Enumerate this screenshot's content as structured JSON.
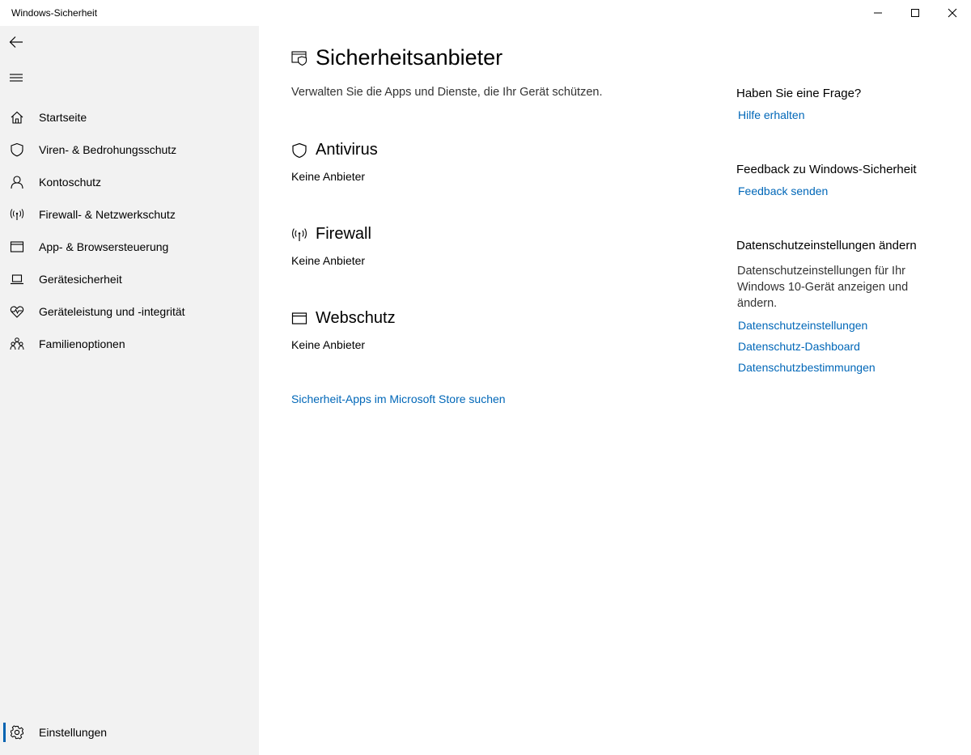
{
  "window": {
    "title": "Windows-Sicherheit"
  },
  "sidebar": {
    "items": [
      {
        "label": "Startseite",
        "icon": "home-icon"
      },
      {
        "label": "Viren- & Bedrohungsschutz",
        "icon": "shield-icon"
      },
      {
        "label": "Kontoschutz",
        "icon": "person-icon"
      },
      {
        "label": "Firewall- & Netzwerkschutz",
        "icon": "antenna-icon"
      },
      {
        "label": "App- & Browsersteuerung",
        "icon": "browser-window-icon"
      },
      {
        "label": "Gerätesicherheit",
        "icon": "laptop-icon"
      },
      {
        "label": "Geräteleistung und -integrität",
        "icon": "heart-pulse-icon"
      },
      {
        "label": "Familienoptionen",
        "icon": "family-icon"
      }
    ],
    "settings_label": "Einstellungen"
  },
  "main": {
    "title": "Sicherheitsanbieter",
    "description": "Verwalten Sie die Apps und Dienste, die Ihr Gerät schützen.",
    "sections": [
      {
        "title": "Antivirus",
        "status": "Keine Anbieter",
        "icon": "shield-icon"
      },
      {
        "title": "Firewall",
        "status": "Keine Anbieter",
        "icon": "antenna-icon"
      },
      {
        "title": "Webschutz",
        "status": "Keine Anbieter",
        "icon": "browser-window-icon"
      }
    ],
    "store_link": "Sicherheit-Apps im Microsoft Store suchen"
  },
  "aside": {
    "question_heading": "Haben Sie eine Frage?",
    "help_link": "Hilfe erhalten",
    "feedback_heading": "Feedback zu Windows-Sicherheit",
    "feedback_link": "Feedback senden",
    "privacy_heading": "Datenschutzeinstellungen ändern",
    "privacy_text": "Datenschutzeinstellungen für Ihr Windows 10-Gerät anzeigen und ändern.",
    "privacy_links": [
      "Datenschutzeinstellungen",
      "Datenschutz-Dashboard",
      "Datenschutzbestimmungen"
    ]
  },
  "colors": {
    "accent": "#0067b8",
    "sidebar_bg": "#f2f2f2",
    "selection_bar": "#0063b1"
  }
}
